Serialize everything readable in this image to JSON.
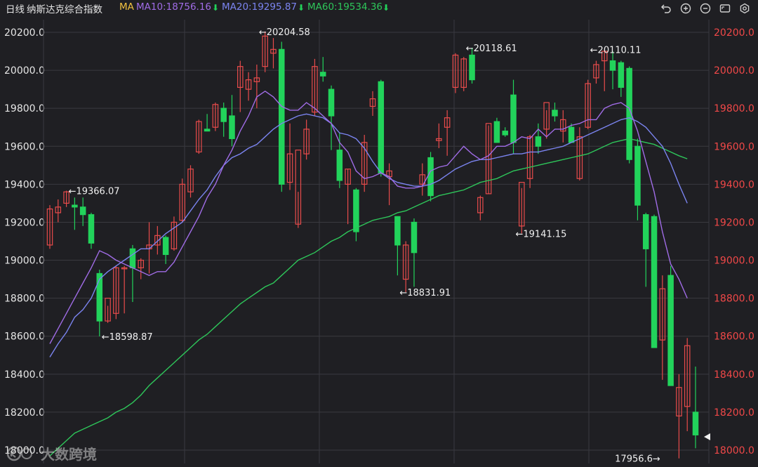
{
  "header": {
    "period": "日线",
    "name": "纳斯达克综合指数",
    "ma_label": "MA",
    "ma10": "MA10:18756.16",
    "ma20": "MA20:19295.87",
    "ma60": "MA60:19534.36",
    "down_arrow": "⬇"
  },
  "toolbar": {
    "icons": [
      "undo-icon",
      "zoom-in-icon",
      "zoom-out-icon",
      "fullscreen-icon",
      "settings-icon"
    ]
  },
  "colors": {
    "background": "#1f1f23",
    "grid": "#3a3a40",
    "up": "#e84b4b",
    "down": "#22d35b",
    "ma10": "#a06ce6",
    "ma20": "#7b84f0",
    "ma60": "#2ec65a",
    "axis_text": "#e6e6e6",
    "axis_text_right": "#f04848"
  },
  "watermark": {
    "text": "大数跨境"
  },
  "chart_data": {
    "type": "candlestick",
    "title": "纳斯达克综合指数",
    "period": "日线",
    "ylim": [
      17900,
      20260
    ],
    "y_ticks": [
      "20200.0",
      "20000.0",
      "19800.0",
      "19600.0",
      "19400.0",
      "19200.0",
      "19000.0",
      "18800.0",
      "18600.0",
      "18400.0",
      "18200.0",
      "18000.0"
    ],
    "grid": true,
    "annotations": [
      {
        "text": "←20204.58",
        "index": 25,
        "value": 20204.58,
        "side": "right"
      },
      {
        "text": "←19366.07",
        "index": 2,
        "value": 19366.07,
        "side": "right"
      },
      {
        "text": "←18598.87",
        "index": 6,
        "value": 18598.87,
        "side": "right"
      },
      {
        "text": "←20118.61",
        "index": 50,
        "value": 20118.61,
        "side": "right"
      },
      {
        "text": "←18831.91",
        "index": 42,
        "value": 18831.91,
        "side": "right"
      },
      {
        "text": "←19141.15",
        "index": 56,
        "value": 19141.15,
        "side": "right"
      },
      {
        "text": "←20110.11",
        "index": 65,
        "value": 20110.11,
        "side": "right"
      },
      {
        "text": "17956.6→",
        "index": 74,
        "value": 17956.6,
        "side": "left"
      }
    ],
    "candles": [
      {
        "o": 19080,
        "h": 19290,
        "l": 19060,
        "c": 19270
      },
      {
        "o": 19250,
        "h": 19320,
        "l": 19200,
        "c": 19280
      },
      {
        "o": 19300,
        "h": 19366.07,
        "l": 19280,
        "c": 19360
      },
      {
        "o": 19290,
        "h": 19330,
        "l": 19160,
        "c": 19280
      },
      {
        "o": 19280,
        "h": 19330,
        "l": 19180,
        "c": 19240
      },
      {
        "o": 19240,
        "h": 19250,
        "l": 19060,
        "c": 19090
      },
      {
        "o": 18930,
        "h": 18950,
        "l": 18598.87,
        "c": 18680
      },
      {
        "o": 18680,
        "h": 18760,
        "l": 18670,
        "c": 18800
      },
      {
        "o": 18720,
        "h": 18970,
        "l": 18690,
        "c": 18960
      },
      {
        "o": 18960,
        "h": 18970,
        "l": 18720,
        "c": 18960
      },
      {
        "o": 19060,
        "h": 19080,
        "l": 18780,
        "c": 18960
      },
      {
        "o": 18960,
        "h": 19010,
        "l": 18900,
        "c": 19000
      },
      {
        "o": 19060,
        "h": 19200,
        "l": 18930,
        "c": 19080
      },
      {
        "o": 19080,
        "h": 19180,
        "l": 19030,
        "c": 19130
      },
      {
        "o": 19120,
        "h": 19130,
        "l": 18980,
        "c": 19030
      },
      {
        "o": 19060,
        "h": 19230,
        "l": 19050,
        "c": 19200
      },
      {
        "o": 19210,
        "h": 19430,
        "l": 19200,
        "c": 19400
      },
      {
        "o": 19360,
        "h": 19500,
        "l": 19330,
        "c": 19480
      },
      {
        "o": 19570,
        "h": 19740,
        "l": 19560,
        "c": 19730
      },
      {
        "o": 19690,
        "h": 19770,
        "l": 19680,
        "c": 19680
      },
      {
        "o": 19700,
        "h": 19830,
        "l": 19680,
        "c": 19820
      },
      {
        "o": 19800,
        "h": 19830,
        "l": 19650,
        "c": 19730
      },
      {
        "o": 19760,
        "h": 19870,
        "l": 19600,
        "c": 19640
      },
      {
        "o": 19910,
        "h": 20050,
        "l": 19780,
        "c": 20020
      },
      {
        "o": 19900,
        "h": 19990,
        "l": 19840,
        "c": 19950
      },
      {
        "o": 19940,
        "h": 20030,
        "l": 19800,
        "c": 19960
      },
      {
        "o": 20020,
        "h": 20204.58,
        "l": 19990,
        "c": 20180
      },
      {
        "o": 20090,
        "h": 20170,
        "l": 20010,
        "c": 20110
      },
      {
        "o": 20110,
        "h": 20150,
        "l": 19360,
        "c": 19400
      },
      {
        "o": 19410,
        "h": 19720,
        "l": 19370,
        "c": 19560
      },
      {
        "o": 19190,
        "h": 19360,
        "l": 19170,
        "c": 19580
      },
      {
        "o": 19560,
        "h": 19740,
        "l": 19530,
        "c": 19690
      },
      {
        "o": 19780,
        "h": 20060,
        "l": 19760,
        "c": 20020
      },
      {
        "o": 19990,
        "h": 20070,
        "l": 19940,
        "c": 19970
      },
      {
        "o": 19900,
        "h": 19920,
        "l": 19580,
        "c": 19760
      },
      {
        "o": 19580,
        "h": 19670,
        "l": 19380,
        "c": 19420
      },
      {
        "o": 19400,
        "h": 19480,
        "l": 19190,
        "c": 19480
      },
      {
        "o": 19370,
        "h": 19380,
        "l": 19100,
        "c": 19150
      },
      {
        "o": 19400,
        "h": 19660,
        "l": 19360,
        "c": 19620
      },
      {
        "o": 19810,
        "h": 19890,
        "l": 19760,
        "c": 19850
      },
      {
        "o": 19940,
        "h": 19950,
        "l": 19440,
        "c": 19460
      },
      {
        "o": 19440,
        "h": 19510,
        "l": 19290,
        "c": 19470
      },
      {
        "o": 19230,
        "h": 19230,
        "l": 18920,
        "c": 19080
      },
      {
        "o": 18900,
        "h": 19100,
        "l": 18831.91,
        "c": 19080
      },
      {
        "o": 19200,
        "h": 19220,
        "l": 18860,
        "c": 19040
      },
      {
        "o": 19400,
        "h": 19510,
        "l": 19340,
        "c": 19450
      },
      {
        "o": 19540,
        "h": 19570,
        "l": 19310,
        "c": 19340
      },
      {
        "o": 19630,
        "h": 19720,
        "l": 19590,
        "c": 19640
      },
      {
        "o": 19700,
        "h": 19790,
        "l": 19550,
        "c": 19750
      },
      {
        "o": 19910,
        "h": 20090,
        "l": 19880,
        "c": 20080
      },
      {
        "o": 19910,
        "h": 20070,
        "l": 19890,
        "c": 20060
      },
      {
        "o": 20080,
        "h": 20118.61,
        "l": 19930,
        "c": 19950
      },
      {
        "o": 19250,
        "h": 19340,
        "l": 19210,
        "c": 19330
      },
      {
        "o": 19350,
        "h": 19710,
        "l": 19350,
        "c": 19720
      },
      {
        "o": 19730,
        "h": 19750,
        "l": 19620,
        "c": 19620
      },
      {
        "o": 19680,
        "h": 19700,
        "l": 19650,
        "c": 19660
      },
      {
        "o": 19870,
        "h": 19950,
        "l": 19560,
        "c": 19620
      },
      {
        "o": 19180,
        "h": 19380,
        "l": 19141.15,
        "c": 19410
      },
      {
        "o": 19430,
        "h": 19660,
        "l": 19380,
        "c": 19650
      },
      {
        "o": 19650,
        "h": 19720,
        "l": 19560,
        "c": 19600
      },
      {
        "o": 19690,
        "h": 19790,
        "l": 19640,
        "c": 19830
      },
      {
        "o": 19790,
        "h": 19830,
        "l": 19730,
        "c": 19760
      },
      {
        "o": 19680,
        "h": 19790,
        "l": 19620,
        "c": 19740
      },
      {
        "o": 19700,
        "h": 19720,
        "l": 19640,
        "c": 19620
      },
      {
        "o": 19430,
        "h": 19700,
        "l": 19420,
        "c": 19650
      },
      {
        "o": 19700,
        "h": 19950,
        "l": 19690,
        "c": 19930
      },
      {
        "o": 19960,
        "h": 20050,
        "l": 19930,
        "c": 20030
      },
      {
        "o": 20050,
        "h": 20110.11,
        "l": 19890,
        "c": 20100
      },
      {
        "o": 20050,
        "h": 20100,
        "l": 19900,
        "c": 20000
      },
      {
        "o": 20040,
        "h": 20050,
        "l": 19860,
        "c": 19910
      },
      {
        "o": 20010,
        "h": 20020,
        "l": 19510,
        "c": 19530
      },
      {
        "o": 19600,
        "h": 19640,
        "l": 19210,
        "c": 19290
      },
      {
        "o": 19240,
        "h": 19250,
        "l": 18860,
        "c": 19060
      },
      {
        "o": 19230,
        "h": 19240,
        "l": 18540,
        "c": 18540
      },
      {
        "o": 18580,
        "h": 18920,
        "l": 18370,
        "c": 18850
      },
      {
        "o": 18920,
        "h": 18970,
        "l": 18340,
        "c": 18340
      },
      {
        "o": 18180,
        "h": 18400,
        "l": 17956.6,
        "c": 18330
      },
      {
        "o": 18230,
        "h": 18590,
        "l": 18100,
        "c": 18550
      },
      {
        "o": 18200,
        "h": 18440,
        "l": 18010,
        "c": 18080
      }
    ],
    "ma10": [
      18560,
      18640,
      18720,
      18800,
      18880,
      18960,
      19050,
      19030,
      19000,
      18980,
      18960,
      18940,
      18920,
      18940,
      18940,
      18990,
      19070,
      19150,
      19230,
      19330,
      19400,
      19500,
      19580,
      19680,
      19760,
      19860,
      19890,
      19860,
      19810,
      19790,
      19790,
      19830,
      19800,
      19760,
      19720,
      19620,
      19570,
      19470,
      19430,
      19440,
      19460,
      19440,
      19390,
      19380,
      19380,
      19390,
      19470,
      19490,
      19500,
      19550,
      19600,
      19560,
      19530,
      19550,
      19600,
      19600,
      19620,
      19650,
      19640,
      19690,
      19650,
      19690,
      19690,
      19710,
      19720,
      19740,
      19740,
      19800,
      19820,
      19830,
      19800,
      19680,
      19520,
      19360,
      19150,
      18980,
      18900,
      18800
    ],
    "ma20": [
      18490,
      18560,
      18620,
      18700,
      18740,
      18800,
      18900,
      18940,
      18970,
      19000,
      19030,
      19060,
      19060,
      19100,
      19140,
      19170,
      19200,
      19260,
      19320,
      19370,
      19440,
      19500,
      19540,
      19560,
      19590,
      19610,
      19650,
      19690,
      19720,
      19740,
      19760,
      19770,
      19760,
      19750,
      19720,
      19670,
      19660,
      19640,
      19590,
      19520,
      19460,
      19430,
      19410,
      19400,
      19390,
      19390,
      19400,
      19420,
      19450,
      19480,
      19500,
      19520,
      19530,
      19530,
      19540,
      19550,
      19560,
      19560,
      19570,
      19570,
      19580,
      19590,
      19600,
      19620,
      19640,
      19660,
      19680,
      19700,
      19720,
      19740,
      19750,
      19730,
      19700,
      19650,
      19600,
      19510,
      19400,
      19300
    ],
    "ma60": [
      17970,
      18010,
      18050,
      18090,
      18110,
      18130,
      18150,
      18170,
      18200,
      18220,
      18250,
      18290,
      18340,
      18380,
      18420,
      18460,
      18500,
      18540,
      18580,
      18610,
      18650,
      18690,
      18730,
      18770,
      18800,
      18830,
      18860,
      18880,
      18920,
      18960,
      19000,
      19020,
      19040,
      19070,
      19100,
      19120,
      19150,
      19170,
      19190,
      19210,
      19220,
      19230,
      19250,
      19260,
      19280,
      19300,
      19320,
      19340,
      19350,
      19360,
      19370,
      19390,
      19410,
      19420,
      19430,
      19450,
      19470,
      19480,
      19490,
      19500,
      19510,
      19520,
      19530,
      19540,
      19550,
      19560,
      19580,
      19600,
      19620,
      19630,
      19640,
      19630,
      19620,
      19610,
      19590,
      19570,
      19550,
      19534
    ]
  }
}
